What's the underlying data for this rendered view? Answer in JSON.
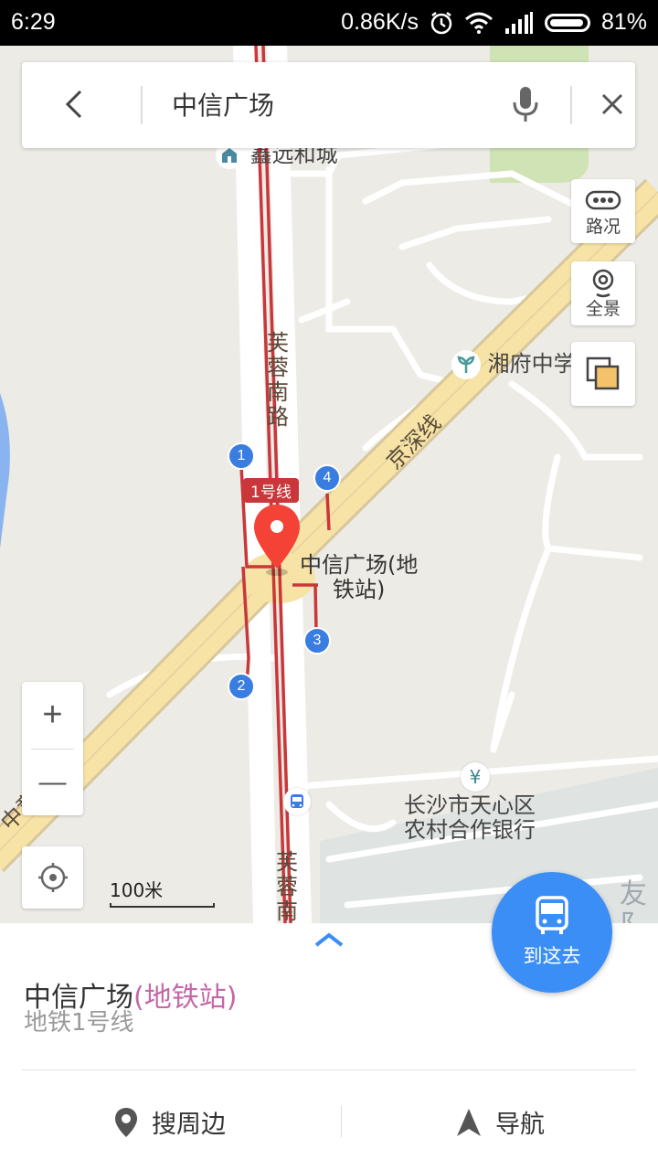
{
  "status_bar": {
    "time": "6:29",
    "speed": "0.86K/s",
    "battery": "81%"
  },
  "search": {
    "query": "中信广场"
  },
  "map": {
    "labels": {
      "poi_xinyuan": "鑫远和城",
      "poi_xiangfu": "湘府中学",
      "road_furong_top": "芙蓉南路",
      "road_furong_bottom": "芙蓉南",
      "road_jingshen": "京深线",
      "road_left_diag": "中意二路",
      "line_badge": "1号线",
      "station": "中信广场(地\n铁站)",
      "bank": "长沙市天心区\n农村合作银行",
      "district_partial": "友阝"
    },
    "exits": [
      "1",
      "2",
      "3",
      "4"
    ],
    "controls": {
      "traffic_label": "路况",
      "panorama_label": "全景",
      "zoom_in": "+",
      "zoom_out": "—"
    },
    "scale_label": "100米"
  },
  "goto_button": {
    "label": "到这去"
  },
  "place_panel": {
    "name_main": "中信广场",
    "name_sub": "(地铁站)",
    "line_info": "地铁1号线",
    "nearby_label": "搜周边",
    "navigate_label": "导航"
  },
  "colors": {
    "accent_blue": "#3a8ef6",
    "pin_red": "#f44336",
    "subway_red": "#c9373a",
    "station_purple": "#c368a8",
    "highway_yellow": "#f7e3a6"
  }
}
